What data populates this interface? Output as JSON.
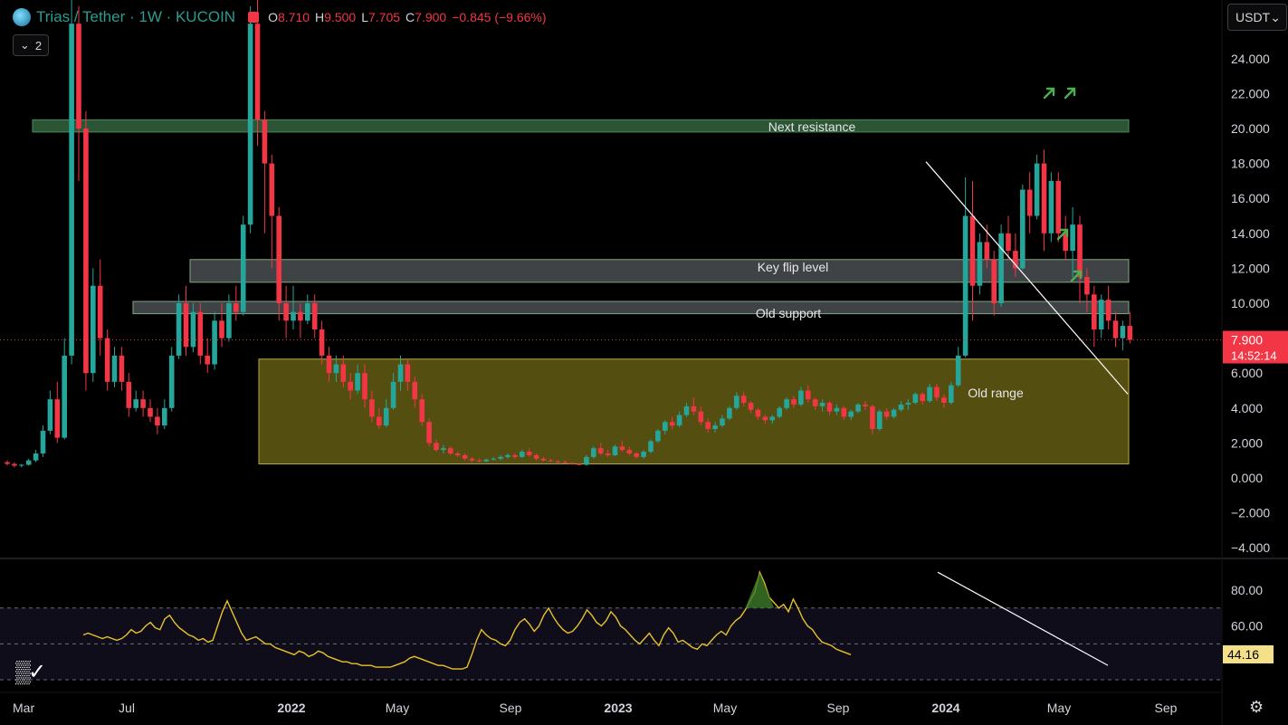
{
  "header": {
    "symbol": "Trias / Tether · 1W · KUCOIN",
    "open_label": "O",
    "open": "8.710",
    "high_label": "H",
    "high": "9.500",
    "low_label": "L",
    "low": "7.705",
    "close_label": "C",
    "close": "7.900",
    "change": "−0.845 (−9.66%)",
    "indicator_count": "2",
    "currency": "USDT"
  },
  "colors": {
    "up": "#26a69a",
    "down": "#f23645",
    "rsi": "#e8c22a",
    "zone_green": "#2d5a38",
    "zone_grey": "#555a5e",
    "zone_olive": "#5a5212",
    "arrow": "#4caf50",
    "trendline": "#ffffff"
  },
  "chart_data": [
    {
      "type": "candlestick",
      "title": "Trias / Tether · 1W · KUCOIN",
      "x_ticks": [
        "Mar",
        "Jul",
        "2022",
        "May",
        "Sep",
        "2023",
        "May",
        "Sep",
        "2024",
        "May",
        "Sep"
      ],
      "y_ticks": [
        "24.000",
        "22.000",
        "20.000",
        "18.000",
        "16.000",
        "14.000",
        "12.000",
        "10.000",
        "6.000",
        "4.000",
        "2.000",
        "0.000",
        "−2.000",
        "−4.000"
      ],
      "ylim": [
        -4.8,
        28
      ],
      "last_price": "7.900",
      "countdown": "14:52:14",
      "zones": [
        {
          "label": "Next resistance",
          "low": 19.8,
          "high": 20.5,
          "start": "2021-03",
          "end": "2024-08"
        },
        {
          "label": "Key flip level",
          "low": 11.2,
          "high": 12.5,
          "start": "2021-10",
          "end": "2024-08"
        },
        {
          "label": "Old support",
          "low": 9.4,
          "high": 10.1,
          "start": "2021-08",
          "end": "2024-08"
        },
        {
          "label": "Old range",
          "low": 0.8,
          "high": 6.8,
          "start": "2022-01",
          "end": "2024-08"
        }
      ],
      "trendline": {
        "from": [
          "2024-01",
          18.1
        ],
        "to": [
          "2024-08",
          4.8
        ]
      },
      "arrows": 5,
      "candles": [
        [
          0.9,
          1.0,
          0.7,
          0.8
        ],
        [
          0.8,
          0.9,
          0.6,
          0.7
        ],
        [
          0.7,
          0.8,
          0.6,
          0.75
        ],
        [
          0.75,
          1.1,
          0.7,
          1.0
        ],
        [
          1.0,
          1.6,
          0.9,
          1.4
        ],
        [
          1.4,
          3.0,
          1.2,
          2.7
        ],
        [
          2.7,
          5.0,
          2.5,
          4.5
        ],
        [
          4.5,
          5.5,
          2.0,
          2.3
        ],
        [
          2.3,
          8.0,
          2.2,
          7.0
        ],
        [
          7.0,
          28.0,
          6.5,
          26.0
        ],
        [
          26.0,
          27.0,
          17.0,
          20.0
        ],
        [
          20.0,
          21.0,
          5.0,
          6.0
        ],
        [
          6.0,
          12.0,
          5.5,
          11.0
        ],
        [
          11.0,
          12.5,
          7.0,
          8.0
        ],
        [
          8.0,
          8.5,
          5.0,
          5.5
        ],
        [
          5.5,
          7.5,
          5.2,
          7.0
        ],
        [
          7.0,
          7.5,
          5.0,
          5.5
        ],
        [
          5.5,
          6.0,
          3.5,
          4.0
        ],
        [
          4.0,
          5.0,
          3.8,
          4.5
        ],
        [
          4.5,
          5.0,
          3.5,
          4.0
        ],
        [
          4.0,
          4.5,
          3.2,
          3.5
        ],
        [
          3.5,
          4.0,
          2.5,
          3.0
        ],
        [
          3.0,
          4.5,
          2.8,
          4.0
        ],
        [
          4.0,
          7.5,
          3.8,
          7.0
        ],
        [
          7.0,
          10.5,
          6.8,
          10.0
        ],
        [
          10.0,
          11.0,
          7.0,
          7.5
        ],
        [
          7.5,
          10.0,
          7.2,
          9.5
        ],
        [
          9.5,
          10.0,
          6.5,
          7.0
        ],
        [
          7.0,
          8.0,
          6.0,
          6.5
        ],
        [
          6.5,
          9.5,
          6.2,
          9.0
        ],
        [
          9.0,
          10.0,
          7.5,
          8.0
        ],
        [
          8.0,
          10.5,
          7.8,
          10.0
        ],
        [
          10.0,
          11.0,
          9.0,
          9.5
        ],
        [
          9.5,
          15.0,
          9.3,
          14.5
        ],
        [
          14.5,
          27.0,
          14.0,
          26.0
        ],
        [
          26.0,
          28.0,
          19.0,
          20.5
        ],
        [
          20.5,
          21.0,
          14.0,
          18.0
        ],
        [
          18.0,
          18.5,
          12.0,
          15.0
        ],
        [
          15.0,
          15.5,
          9.0,
          10.0
        ],
        [
          10.0,
          11.0,
          8.0,
          9.0
        ],
        [
          9.0,
          11.0,
          8.5,
          9.5
        ],
        [
          9.5,
          10.0,
          8.0,
          9.0
        ],
        [
          9.0,
          10.5,
          8.8,
          10.0
        ],
        [
          10.0,
          10.5,
          8.0,
          8.5
        ],
        [
          8.5,
          9.0,
          6.5,
          7.0
        ],
        [
          7.0,
          7.5,
          5.5,
          6.0
        ],
        [
          6.0,
          7.0,
          5.5,
          6.5
        ],
        [
          6.5,
          7.0,
          5.2,
          5.5
        ],
        [
          5.5,
          6.0,
          4.5,
          5.0
        ],
        [
          5.0,
          6.5,
          4.8,
          6.0
        ],
        [
          6.0,
          6.5,
          4.0,
          4.5
        ],
        [
          4.5,
          5.0,
          3.2,
          3.5
        ],
        [
          3.5,
          4.0,
          2.8,
          3.0
        ],
        [
          3.0,
          4.5,
          2.9,
          4.0
        ],
        [
          4.0,
          6.0,
          3.9,
          5.5
        ],
        [
          5.5,
          7.0,
          5.0,
          6.5
        ],
        [
          6.5,
          6.8,
          5.0,
          5.5
        ],
        [
          5.5,
          5.8,
          4.0,
          4.5
        ],
        [
          4.5,
          4.8,
          3.0,
          3.2
        ],
        [
          3.2,
          3.4,
          1.8,
          2.0
        ],
        [
          2.0,
          2.2,
          1.5,
          1.6
        ],
        [
          1.6,
          1.9,
          1.4,
          1.7
        ],
        [
          1.7,
          1.8,
          1.3,
          1.4
        ],
        [
          1.4,
          1.5,
          1.2,
          1.3
        ],
        [
          1.3,
          1.4,
          1.0,
          1.1
        ],
        [
          1.1,
          1.2,
          0.9,
          1.0
        ],
        [
          1.0,
          1.1,
          0.9,
          0.95
        ],
        [
          0.95,
          1.1,
          0.9,
          1.05
        ],
        [
          1.05,
          1.2,
          1.0,
          1.1
        ],
        [
          1.1,
          1.3,
          1.0,
          1.2
        ],
        [
          1.2,
          1.4,
          1.1,
          1.3
        ],
        [
          1.3,
          1.4,
          1.1,
          1.2
        ],
        [
          1.2,
          1.6,
          1.15,
          1.5
        ],
        [
          1.5,
          1.7,
          1.2,
          1.3
        ],
        [
          1.3,
          1.4,
          1.0,
          1.1
        ],
        [
          1.1,
          1.2,
          0.95,
          1.0
        ],
        [
          1.0,
          1.1,
          0.9,
          0.95
        ],
        [
          0.95,
          1.0,
          0.85,
          0.9
        ],
        [
          0.9,
          1.0,
          0.8,
          0.85
        ],
        [
          0.85,
          0.9,
          0.75,
          0.8
        ],
        [
          0.8,
          0.85,
          0.7,
          0.75
        ],
        [
          0.75,
          1.3,
          0.7,
          1.2
        ],
        [
          1.2,
          1.8,
          1.1,
          1.7
        ],
        [
          1.7,
          2.0,
          1.3,
          1.4
        ],
        [
          1.4,
          1.6,
          1.2,
          1.3
        ],
        [
          1.3,
          1.9,
          1.25,
          1.8
        ],
        [
          1.8,
          2.1,
          1.5,
          1.6
        ],
        [
          1.6,
          1.8,
          1.3,
          1.4
        ],
        [
          1.4,
          1.5,
          1.1,
          1.2
        ],
        [
          1.2,
          1.6,
          1.1,
          1.5
        ],
        [
          1.5,
          2.2,
          1.4,
          2.1
        ],
        [
          2.1,
          2.8,
          2.0,
          2.7
        ],
        [
          2.7,
          3.3,
          2.5,
          3.2
        ],
        [
          3.2,
          3.5,
          2.8,
          3.0
        ],
        [
          3.0,
          3.8,
          2.9,
          3.6
        ],
        [
          3.6,
          4.3,
          3.5,
          4.1
        ],
        [
          4.1,
          4.6,
          3.6,
          3.8
        ],
        [
          3.8,
          4.1,
          3.0,
          3.2
        ],
        [
          3.2,
          3.4,
          2.6,
          2.8
        ],
        [
          2.8,
          3.2,
          2.6,
          3.0
        ],
        [
          3.0,
          3.6,
          2.9,
          3.4
        ],
        [
          3.4,
          4.1,
          3.3,
          4.0
        ],
        [
          4.0,
          4.9,
          3.9,
          4.7
        ],
        [
          4.7,
          4.9,
          4.1,
          4.3
        ],
        [
          4.3,
          4.4,
          3.7,
          3.9
        ],
        [
          3.9,
          4.0,
          3.3,
          3.5
        ],
        [
          3.5,
          3.6,
          3.1,
          3.3
        ],
        [
          3.3,
          3.6,
          3.1,
          3.5
        ],
        [
          3.5,
          4.1,
          3.4,
          4.0
        ],
        [
          4.0,
          4.6,
          3.9,
          4.5
        ],
        [
          4.5,
          4.7,
          4.0,
          4.2
        ],
        [
          4.2,
          5.2,
          4.1,
          5.0
        ],
        [
          5.0,
          5.3,
          4.3,
          4.5
        ],
        [
          4.5,
          4.6,
          3.9,
          4.1
        ],
        [
          4.1,
          4.5,
          3.8,
          4.3
        ],
        [
          4.3,
          4.4,
          3.6,
          3.8
        ],
        [
          3.8,
          4.2,
          3.6,
          4.0
        ],
        [
          4.0,
          4.1,
          3.3,
          3.5
        ],
        [
          3.5,
          3.9,
          3.3,
          3.8
        ],
        [
          3.8,
          4.3,
          3.7,
          4.2
        ],
        [
          4.2,
          4.4,
          3.9,
          4.1
        ],
        [
          4.1,
          4.2,
          2.5,
          2.8
        ],
        [
          2.8,
          3.9,
          2.7,
          3.8
        ],
        [
          3.8,
          4.0,
          3.3,
          3.5
        ],
        [
          3.5,
          4.0,
          3.4,
          3.9
        ],
        [
          3.9,
          4.4,
          3.8,
          4.2
        ],
        [
          4.2,
          4.5,
          3.9,
          4.3
        ],
        [
          4.3,
          4.9,
          4.2,
          4.8
        ],
        [
          4.8,
          4.9,
          4.2,
          4.4
        ],
        [
          4.4,
          5.4,
          4.3,
          5.2
        ],
        [
          5.2,
          5.4,
          4.4,
          4.6
        ],
        [
          4.6,
          4.8,
          4.0,
          4.3
        ],
        [
          4.3,
          5.5,
          4.2,
          5.3
        ],
        [
          5.3,
          7.5,
          5.2,
          7.0
        ],
        [
          7.0,
          17.2,
          6.9,
          15.0
        ],
        [
          15.0,
          17.0,
          9.0,
          11.0
        ],
        [
          11.0,
          14.0,
          10.5,
          13.5
        ],
        [
          13.5,
          14.5,
          12.0,
          12.5
        ],
        [
          12.5,
          13.0,
          9.3,
          10.0
        ],
        [
          10.0,
          14.5,
          9.8,
          14.0
        ],
        [
          14.0,
          15.0,
          12.5,
          13.0
        ],
        [
          13.0,
          14.0,
          11.5,
          12.0
        ],
        [
          12.0,
          16.8,
          11.9,
          16.5
        ],
        [
          16.5,
          17.5,
          14.0,
          15.0
        ],
        [
          15.0,
          18.5,
          14.8,
          18.0
        ],
        [
          18.0,
          18.8,
          13.0,
          14.0
        ],
        [
          14.0,
          17.5,
          13.5,
          17.0
        ],
        [
          17.0,
          17.5,
          13.5,
          14.0
        ],
        [
          14.0,
          15.0,
          12.5,
          13.0
        ],
        [
          13.0,
          15.5,
          11.5,
          14.5
        ],
        [
          14.5,
          15.0,
          10.0,
          11.5
        ],
        [
          11.5,
          12.0,
          9.5,
          10.5
        ],
        [
          10.5,
          11.0,
          7.5,
          8.5
        ],
        [
          8.5,
          10.5,
          8.0,
          10.2
        ],
        [
          10.2,
          11.0,
          8.5,
          9.0
        ],
        [
          9.0,
          9.5,
          7.5,
          8.0
        ],
        [
          8.0,
          9.0,
          7.3,
          8.7
        ],
        [
          8.7,
          9.5,
          7.7,
          7.9
        ]
      ]
    },
    {
      "type": "line",
      "name": "RSI",
      "y_ticks": [
        "80.00",
        "60.00"
      ],
      "last_value": "44.16",
      "ylim": [
        34,
        94
      ],
      "bands": [
        70,
        50,
        30
      ],
      "trendline": {
        "from": [
          "2024-01",
          90
        ],
        "to": [
          "2024-08",
          38
        ]
      },
      "values": [
        55,
        56,
        55,
        54,
        53,
        54,
        53,
        52,
        53,
        55,
        58,
        56,
        57,
        60,
        62,
        59,
        58,
        64,
        66,
        62,
        59,
        57,
        55,
        54,
        52,
        53,
        51,
        52,
        60,
        68,
        74,
        68,
        62,
        56,
        52,
        53,
        54,
        52,
        50,
        50,
        48,
        47,
        46,
        45,
        44,
        46,
        45,
        43,
        44,
        46,
        45,
        43,
        42,
        41,
        40,
        40,
        39,
        39,
        38,
        38,
        38,
        37,
        37,
        37,
        37,
        38,
        39,
        40,
        42,
        43,
        42,
        41,
        40,
        39,
        38,
        38,
        37,
        36,
        36,
        36,
        37,
        44,
        52,
        58,
        55,
        53,
        52,
        50,
        49,
        52,
        58,
        62,
        64,
        61,
        57,
        60,
        66,
        70,
        65,
        61,
        58,
        56,
        57,
        60,
        64,
        69,
        66,
        62,
        60,
        63,
        68,
        65,
        60,
        58,
        55,
        52,
        50,
        53,
        56,
        52,
        49,
        55,
        59,
        56,
        51,
        52,
        50,
        48,
        47,
        50,
        49,
        52,
        55,
        57,
        55,
        60,
        63,
        65,
        69,
        74,
        79,
        90,
        84,
        76,
        73,
        70,
        72,
        68,
        75,
        70,
        64,
        60,
        58,
        54,
        51,
        50,
        49,
        47,
        46,
        45,
        44
      ]
    }
  ]
}
